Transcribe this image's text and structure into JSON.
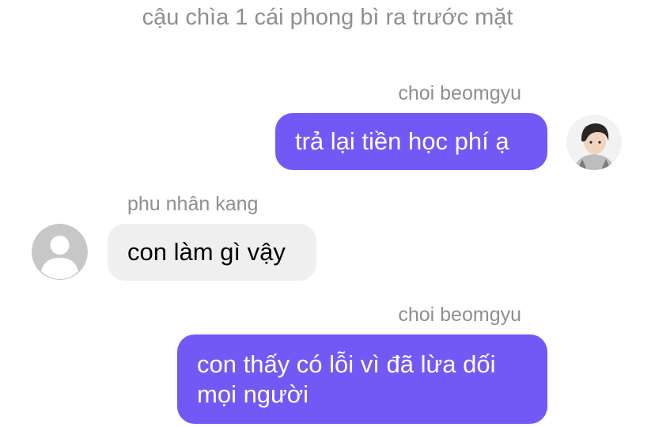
{
  "narration": "cậu chìa 1 cái phong bì ra trước mặt",
  "messages": [
    {
      "sender": "choi beomgyu",
      "text": "trả lại tiền học phí ạ",
      "side": "outgoing"
    },
    {
      "sender": "phu nhân kang",
      "text": "con làm gì vậy",
      "side": "incoming"
    },
    {
      "sender": "choi beomgyu",
      "text": "con thấy có lỗi vì đã lừa dối mọi người",
      "side": "outgoing"
    }
  ],
  "colors": {
    "outgoing_bubble": "#7259f5",
    "incoming_bubble": "#efeff0",
    "meta_text": "#8e8e93"
  },
  "icons": {
    "user_avatar": "photo-avatar",
    "contact_avatar": "default-person-icon"
  }
}
